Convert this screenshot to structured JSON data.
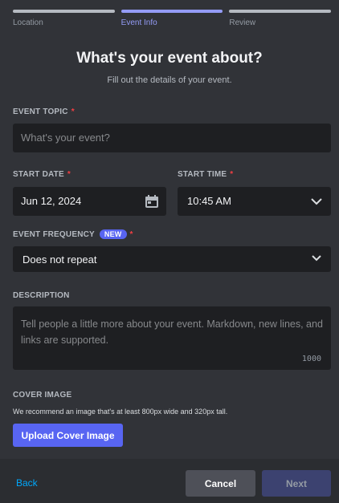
{
  "steps": [
    {
      "label": "Location"
    },
    {
      "label": "Event Info"
    },
    {
      "label": "Review"
    }
  ],
  "heading": {
    "title": "What's your event about?",
    "subtitle": "Fill out the details of your event."
  },
  "form": {
    "topic": {
      "label": "EVENT TOPIC",
      "required": "*",
      "placeholder": "What's your event?"
    },
    "start_date": {
      "label": "START DATE",
      "required": "*",
      "value": "Jun 12, 2024"
    },
    "start_time": {
      "label": "START TIME",
      "required": "*",
      "value": "10:45 AM"
    },
    "frequency": {
      "label": "EVENT FREQUENCY",
      "badge": "NEW",
      "required": "*",
      "value": "Does not repeat"
    },
    "description": {
      "label": "DESCRIPTION",
      "placeholder": "Tell people a little more about your event. Markdown, new lines, and links are supported.",
      "char_limit": "1000"
    },
    "cover": {
      "label": "COVER IMAGE",
      "note": "We recommend an image that's at least 800px wide and 320px tall.",
      "button": "Upload Cover Image"
    }
  },
  "footer": {
    "back": "Back",
    "cancel": "Cancel",
    "next": "Next"
  },
  "colors": {
    "accent": "#5865f2",
    "step_active": "#949cf7",
    "link": "#00a8fc",
    "required": "#f23f43"
  },
  "icons": {
    "date": "calendar-icon",
    "time": "chevron-down-icon",
    "frequency": "chevron-down-icon"
  }
}
